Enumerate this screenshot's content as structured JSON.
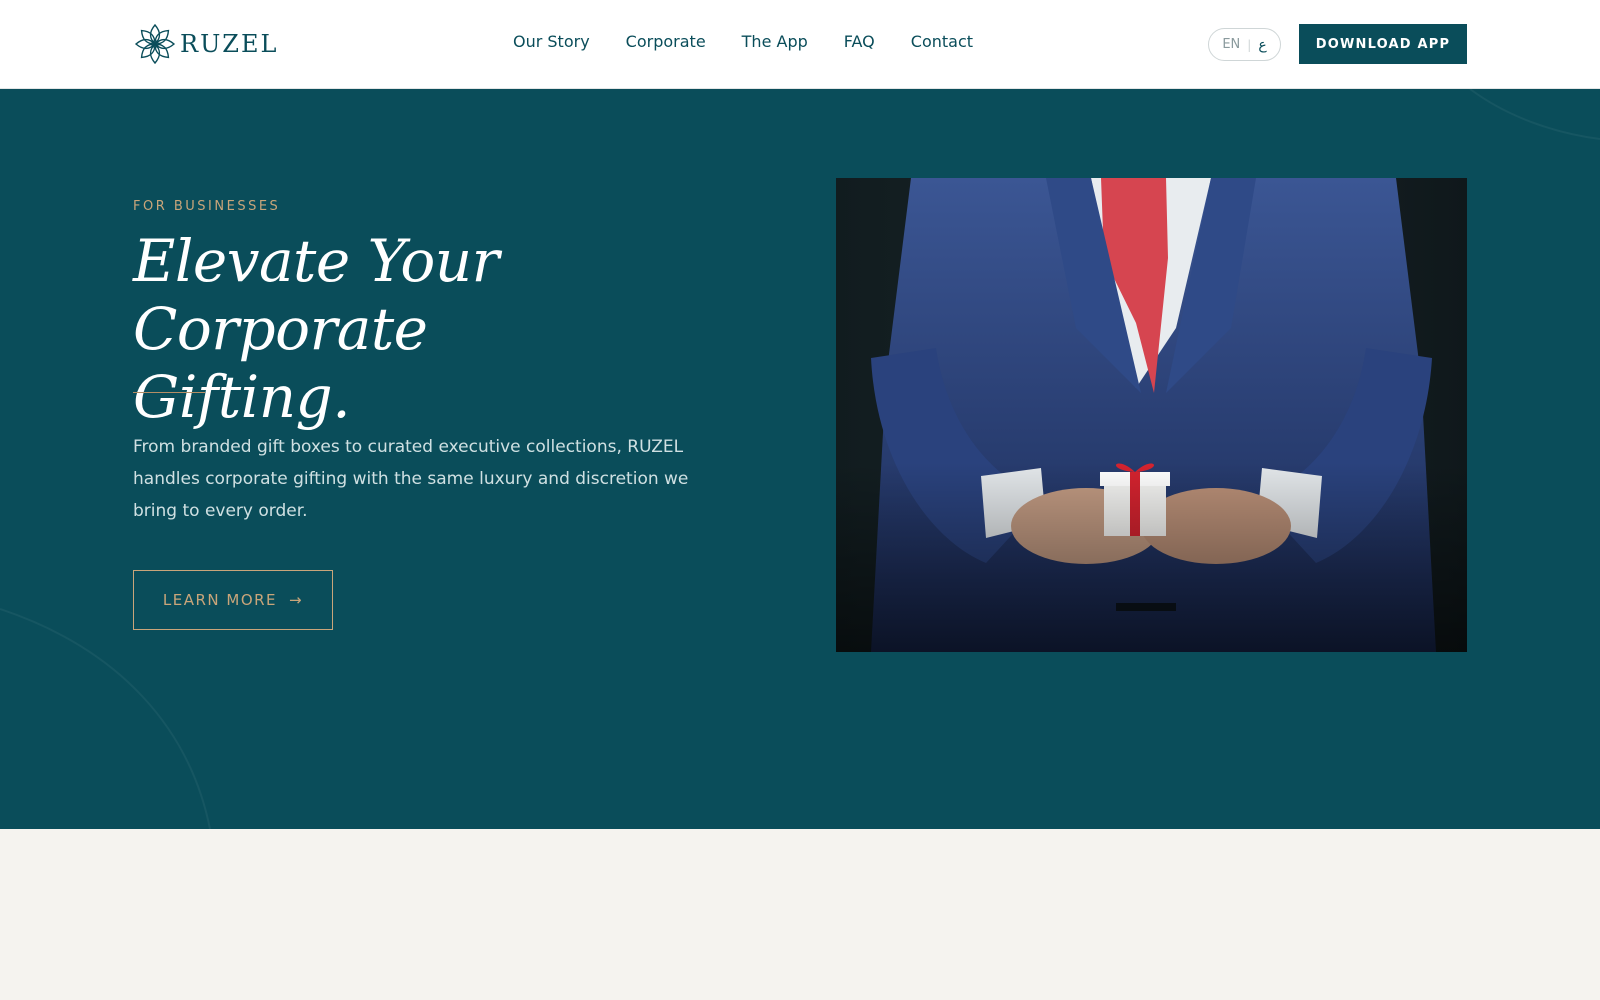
{
  "brand": {
    "name": "RUZEL",
    "logo_icon": "lotus-star-icon"
  },
  "nav": {
    "items": [
      "Our Story",
      "Corporate",
      "The App",
      "FAQ",
      "Contact"
    ]
  },
  "lang": {
    "current": "EN",
    "separator": "|",
    "alt": "ع"
  },
  "header": {
    "download_label": "DOWNLOAD APP"
  },
  "hero": {
    "eyebrow": "FOR BUSINESSES",
    "title_line1": "Elevate Your Corporate",
    "title_line2": "Gifting.",
    "description": "From branded gift boxes to curated executive collections, RUZEL handles corporate gifting with the same luxury and discretion we bring to every order.",
    "cta_label": "LEARN MORE",
    "cta_icon": "arrow-right-icon"
  },
  "colors": {
    "primary": "#0a4d5a",
    "accent_gold": "#c9a57a",
    "background_light": "#f5f3ef",
    "white": "#ffffff"
  }
}
